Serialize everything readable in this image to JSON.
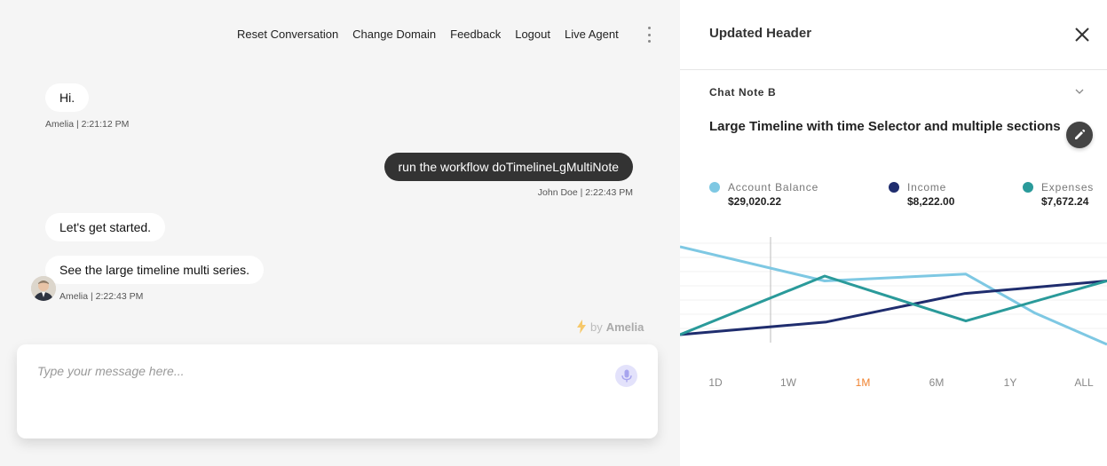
{
  "nav": {
    "items": [
      "Reset Conversation",
      "Change Domain",
      "Feedback",
      "Logout",
      "Live Agent"
    ]
  },
  "messages": {
    "m1": {
      "text": "Hi.",
      "meta": "Amelia | 2:21:12 PM"
    },
    "m2": {
      "text": "run the workflow doTimelineLgMultiNote",
      "meta": "John Doe | 2:22:43 PM"
    },
    "m3": {
      "text": "Let's get started."
    },
    "m4": {
      "text": "See the large timeline multi series.",
      "meta": "Amelia | 2:22:43 PM"
    }
  },
  "powered": {
    "by": "by",
    "brand": "Amelia"
  },
  "composer": {
    "placeholder": "Type your message here..."
  },
  "panel": {
    "header": "Updated Header",
    "note_title": "Chat Note B",
    "timeline_title": "Large Timeline with time Selector and multiple sections"
  },
  "legend": [
    {
      "name": "Account Balance",
      "value": "$29,020.22",
      "color": "#7ec8e3"
    },
    {
      "name": "Income",
      "value": "$8,222.00",
      "color": "#1f2d6e"
    },
    {
      "name": "Expenses",
      "value": "$7,672.24",
      "color": "#2a9a9a"
    }
  ],
  "ranges": {
    "items": [
      "1D",
      "1W",
      "1M",
      "6M",
      "1Y",
      "ALL"
    ],
    "active": "1M"
  },
  "chart_data": {
    "type": "line",
    "x": [
      0,
      1,
      2,
      3,
      4
    ],
    "series": [
      {
        "name": "Account Balance",
        "color": "#7ec8e3",
        "values": [
          0.9,
          0.55,
          0.62,
          0.22,
          -0.1
        ]
      },
      {
        "name": "Income",
        "color": "#1f2d6e",
        "values": [
          0.0,
          0.13,
          0.42,
          0.55,
          null
        ]
      },
      {
        "name": "Expenses",
        "color": "#2a9a9a",
        "values": [
          0.0,
          0.6,
          0.14,
          0.55,
          null
        ]
      }
    ]
  }
}
